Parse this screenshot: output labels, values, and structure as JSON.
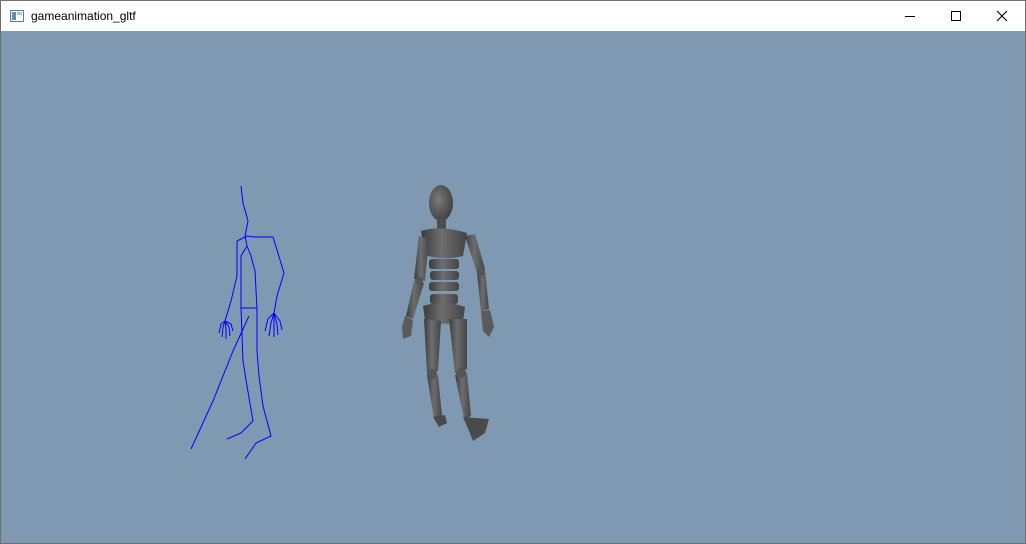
{
  "window": {
    "title": "gameanimation_gltf",
    "icon": "app-window-icon",
    "controls": [
      "minimize-icon",
      "maximize-icon",
      "close-icon"
    ]
  },
  "viewport": {
    "background": "#7f99b2",
    "skeleton_color": "#0000ff",
    "mesh_color": "#505050"
  }
}
